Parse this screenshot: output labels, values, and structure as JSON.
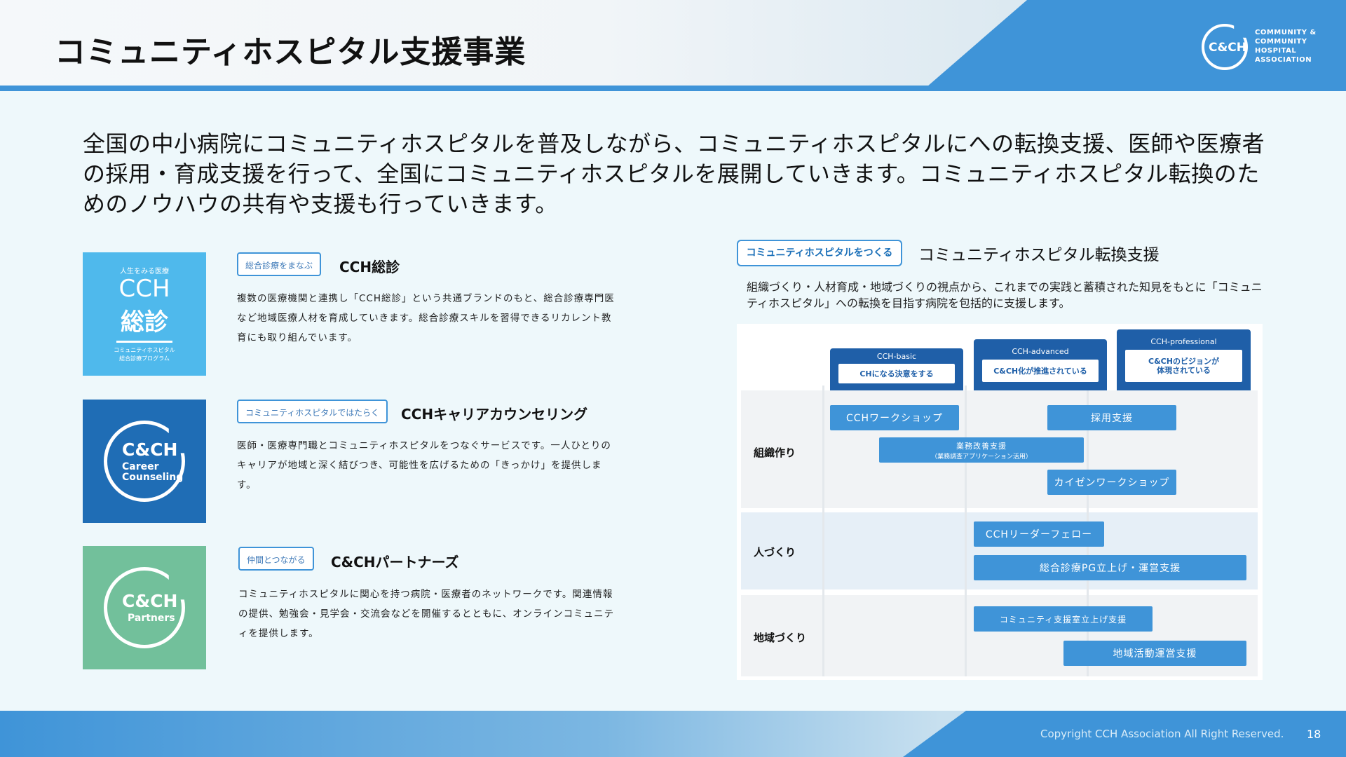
{
  "header": {
    "title": "コミュニティホスピタル支援事業",
    "logo_mark": "C&CH",
    "logo_text": "COMMUNITY & COMMUNITY HOSPITAL ASSOCIATION"
  },
  "intro": "全国の中小病院にコミュニティホスピタルを普及しながら、コミュニティホスピタルにへの転換支援、医師や医療者の採用・育成支援を行って、全国にコミュニティホスピタルを展開していきます。コミュニティホスピタル転換のためのノウハウの共有や支援も行っていきます。",
  "programs": [
    {
      "tag": "総合診療をまなぶ",
      "name": "CCH総診",
      "desc": "複数の医療機関と連携し「CCH総診」という共通ブランドのもと、総合診療専門医など地域医療人材を育成していきます。総合診療スキルを習得できるリカレント教育にも取り組んでいます。",
      "logo_small": "人生をみる医療",
      "logo_main1": "CCH",
      "logo_main2": "総診",
      "logo_foot1": "コミュニティホスピタル",
      "logo_foot2": "総合診療プログラム",
      "color": "#4fb9ec"
    },
    {
      "tag": "コミュニティホスピタルではたらく",
      "name": "CCHキャリアカウンセリング",
      "desc": "医師・医療専門職とコミュニティホスピタルをつなぐサービスです。一人ひとりのキャリアが地域と深く結びつき、可能性を広げるための「きっかけ」を提供します。",
      "logo_main": "C&CH",
      "logo_sub1": "Career",
      "logo_sub2": "Counseling",
      "color": "#1f6db5"
    },
    {
      "tag": "仲間とつながる",
      "name": "C&CHパートナーズ",
      "desc": "コミュニティホスピタルに関心を持つ病院・医療者のネットワークです。関連情報の提供、勉強会・見学会・交流会などを開催するとともに、オンラインコミュニティを提供します。",
      "logo_main": "C&CH",
      "logo_sub1": "Partners",
      "color": "#72c09b"
    }
  ],
  "transition": {
    "tag": "コミュニティホスピタルをつくる",
    "title": "コミュニティホスピタル転換支援",
    "desc": "組織づくり・人材育成・地域づくりの視点から、これまでの実践と蓄積された知見をもとに「コミュニティホスピタル」への転換を目指す病院を包括的に支援します。",
    "levels": [
      {
        "name": "CCH-basic",
        "desc": "CHになる決意をする"
      },
      {
        "name": "CCH-advanced",
        "desc": "C&CH化が推進されている"
      },
      {
        "name": "CCH-professional",
        "desc1": "C&CHのビジョンが",
        "desc2": "体現されている"
      }
    ],
    "rows": [
      "組織作り",
      "人づくり",
      "地域づくり"
    ],
    "bars": {
      "workshop": "CCHワークショップ",
      "recruit": "採用支援",
      "bizimprove": "業務改善支援",
      "bizimprove_sub": "（業務調査アプリケーション活用）",
      "kaizen": "カイゼンワークショップ",
      "leader": "CCHリーダーフェロー",
      "pg": "総合診療PG立上げ・運営支援",
      "commroom": "コミュニティ支援室立上げ支援",
      "regional": "地域活動運営支援"
    }
  },
  "footer": {
    "copyright": "Copyright CCH Association All Right Reserved.",
    "page": "18"
  }
}
